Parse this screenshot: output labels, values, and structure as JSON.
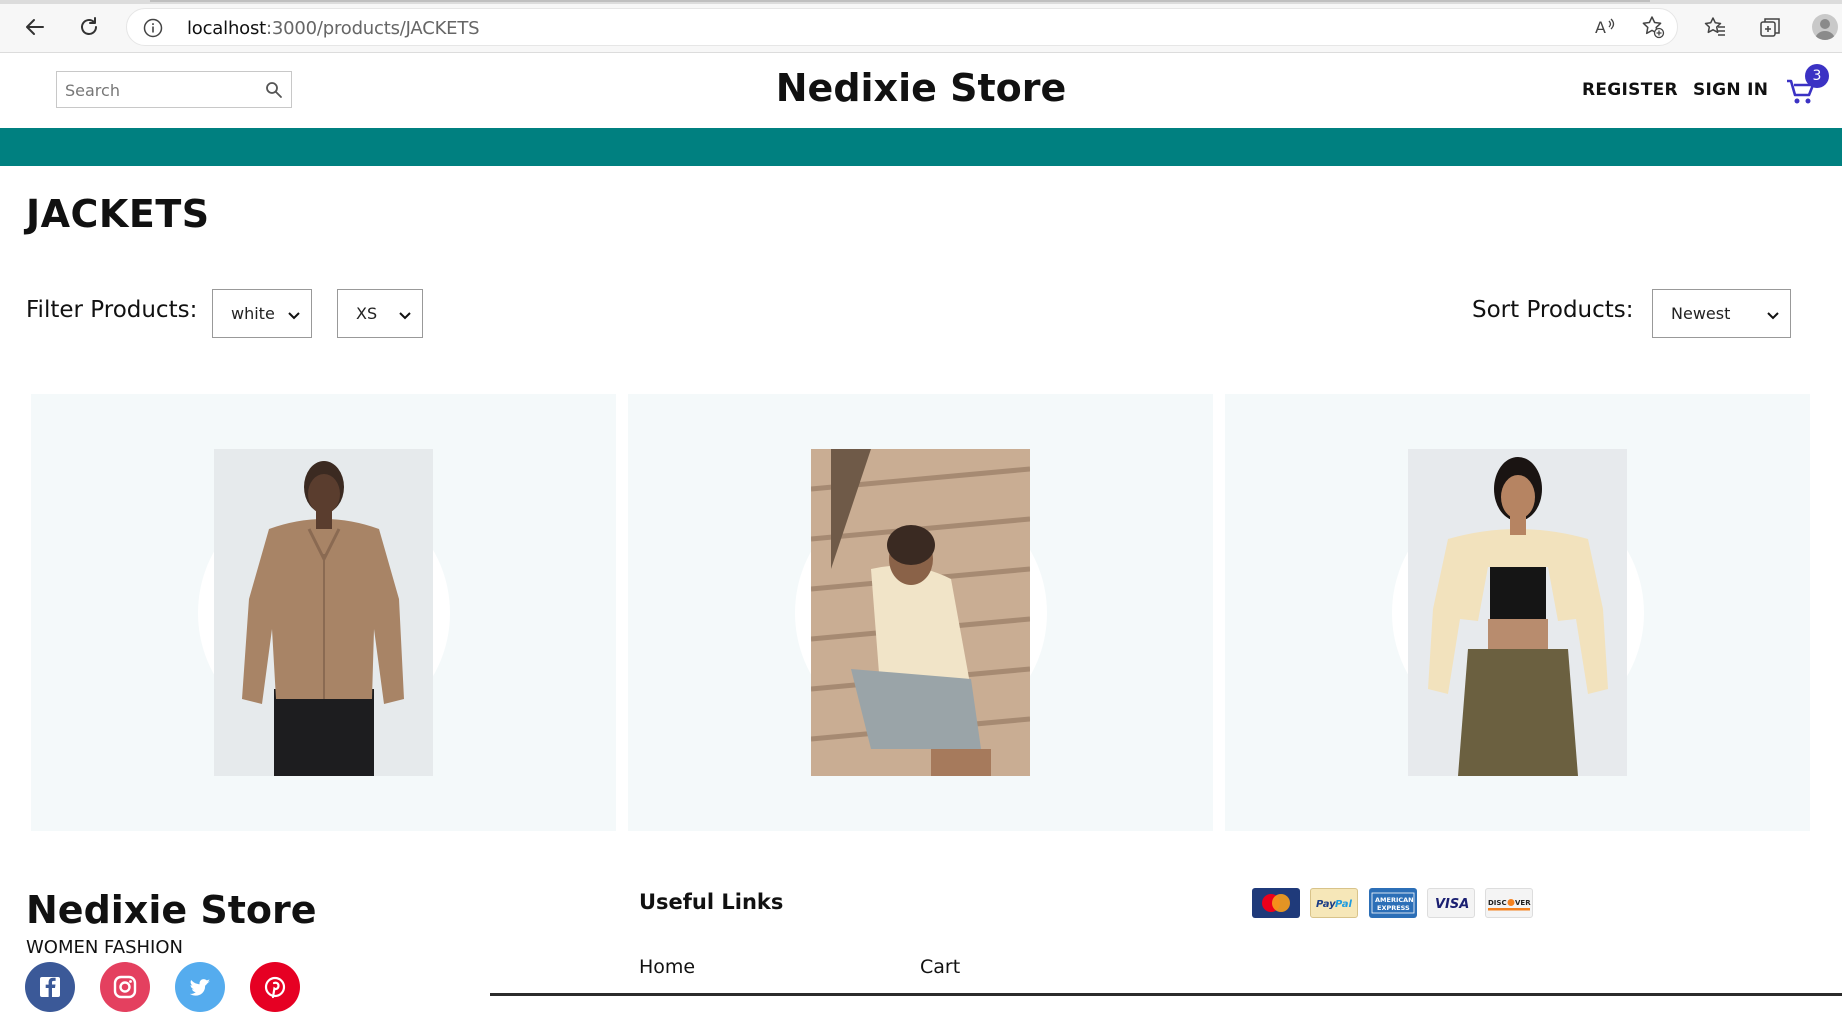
{
  "browser": {
    "url_host": "localhost",
    "url_path": ":3000/products/JACKETS"
  },
  "header": {
    "search_placeholder": "Search",
    "logo": "Nedixie Store",
    "register": "REGISTER",
    "signin": "SIGN IN",
    "cart_count": "3"
  },
  "colors": {
    "teal_band": "#008080",
    "badge": "#3b32c4",
    "card_bg": "#f4f9fa"
  },
  "page": {
    "title": "JACKETS",
    "filter_label": "Filter Products:",
    "filter_color": "white",
    "filter_size": "XS",
    "sort_label": "Sort Products:",
    "sort_value": "Newest"
  },
  "products": [
    {
      "icon": "jacket-brown-photo"
    },
    {
      "icon": "jacket-cream-stairs-photo"
    },
    {
      "icon": "jacket-cream-cropped-photo"
    }
  ],
  "footer": {
    "logo": "Nedixie Store",
    "description": "WOMEN FASHION",
    "useful_links_title": "Useful Links",
    "links": [
      "Home",
      "Cart"
    ],
    "payments": [
      "MasterCard",
      "PayPal",
      "AMERICAN EXPRESS",
      "VISA",
      "DISCOVER"
    ]
  }
}
